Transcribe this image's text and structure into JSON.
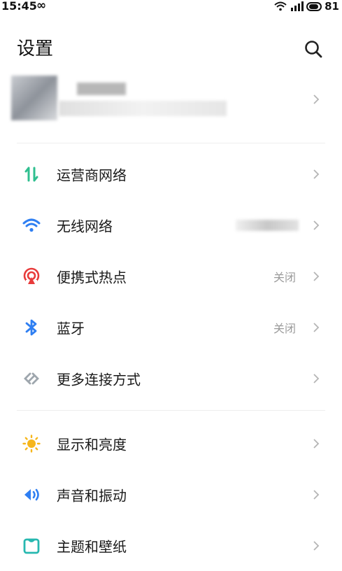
{
  "status_bar": {
    "time": "15:45",
    "infinity": "∞",
    "battery": "81"
  },
  "header": {
    "title": "设置"
  },
  "groups": {
    "network": [
      {
        "label": "运营商网络",
        "value": ""
      },
      {
        "label": "无线网络",
        "value": ""
      },
      {
        "label": "便携式热点",
        "value": "关闭"
      },
      {
        "label": "蓝牙",
        "value": "关闭"
      },
      {
        "label": "更多连接方式",
        "value": ""
      }
    ],
    "display": [
      {
        "label": "显示和亮度"
      },
      {
        "label": "声音和振动"
      },
      {
        "label": "主题和壁纸"
      }
    ]
  },
  "colors": {
    "carrier": "#2fbf8f",
    "wifi": "#2f7ff2",
    "hotspot": "#e83b3b",
    "bluetooth": "#2f7ff2",
    "more": "#9ea6ad",
    "display": "#f6b61c",
    "sound": "#2f7ff2",
    "theme": "#27b8b0"
  },
  "icons": [
    "carrier-network-icon",
    "wifi-icon",
    "hotspot-icon",
    "bluetooth-icon",
    "more-connections-icon",
    "brightness-icon",
    "sound-icon",
    "theme-icon",
    "search-icon",
    "chevron-right-icon"
  ]
}
